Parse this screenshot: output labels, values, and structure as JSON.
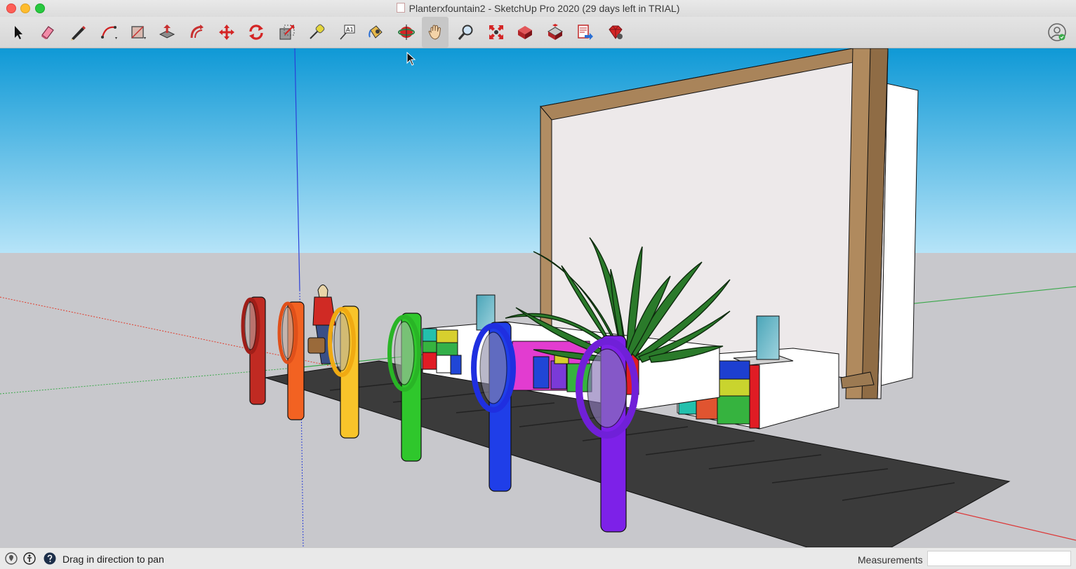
{
  "window": {
    "title": "Planterxfountain2 - SketchUp Pro 2020 (29 days left in TRIAL)"
  },
  "toolbar": {
    "tools": [
      {
        "name": "select-tool-icon"
      },
      {
        "name": "eraser-tool-icon"
      },
      {
        "name": "line-tool-icon"
      },
      {
        "name": "arc-tool-icon"
      },
      {
        "name": "rectangle-tool-icon"
      },
      {
        "name": "push-pull-tool-icon"
      },
      {
        "name": "offset-tool-icon"
      },
      {
        "name": "move-tool-icon"
      },
      {
        "name": "rotate-tool-icon"
      },
      {
        "name": "scale-tool-icon"
      },
      {
        "name": "tape-measure-tool-icon"
      },
      {
        "name": "text-tool-icon"
      },
      {
        "name": "paint-bucket-tool-icon"
      },
      {
        "name": "orbit-tool-icon"
      },
      {
        "name": "pan-tool-icon",
        "active": true
      },
      {
        "name": "zoom-tool-icon"
      },
      {
        "name": "zoom-extents-tool-icon"
      },
      {
        "name": "3d-warehouse-icon"
      },
      {
        "name": "extension-warehouse-icon"
      },
      {
        "name": "send-to-layout-icon"
      },
      {
        "name": "extension-manager-icon"
      }
    ]
  },
  "status": {
    "message": "Drag in direction to pan",
    "measurements_label": "Measurements",
    "measurements_value": ""
  },
  "colors": {
    "sky_top": "#0f99d6",
    "sky_bottom": "#b6e4f8",
    "ground": "#c8c8cc",
    "red_axis": "#e03a2a",
    "green_axis": "#3aa84a",
    "blue_axis": "#2b3fd8"
  }
}
